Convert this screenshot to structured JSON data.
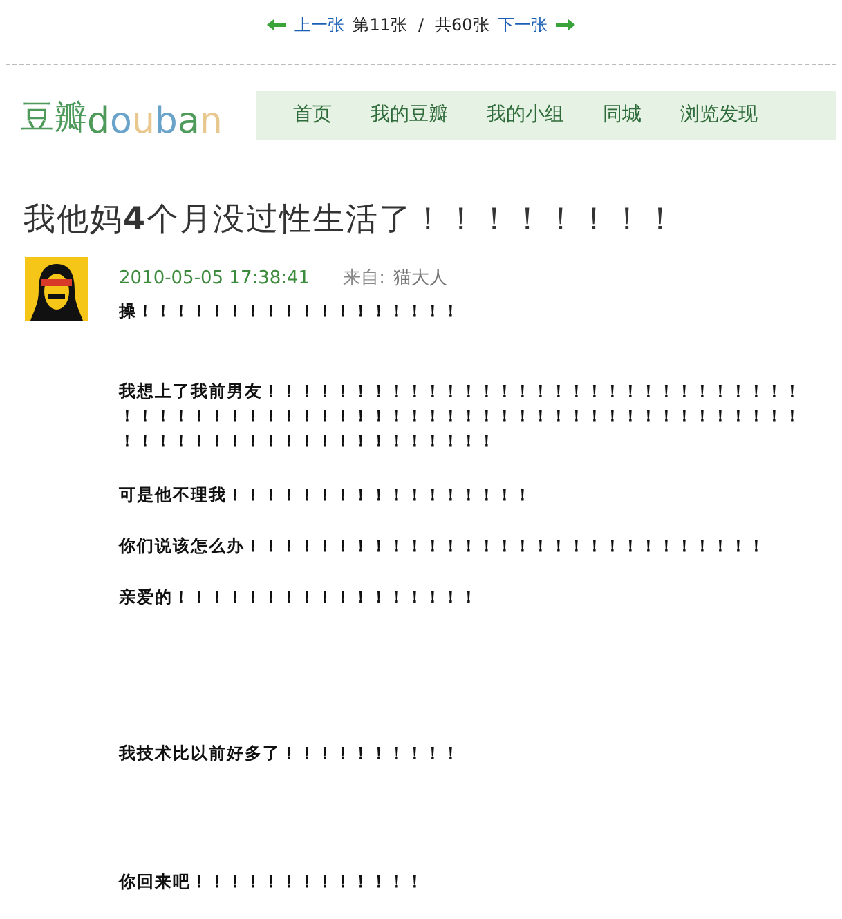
{
  "pager": {
    "prev": "上一张",
    "current": "第11张",
    "separator": "/",
    "total": "共60张",
    "next": "下一张"
  },
  "header": {
    "logo_cn": "豆瓣",
    "logo_en": "douban",
    "nav": [
      "首页",
      "我的豆瓣",
      "我的小组",
      "同城",
      "浏览发现"
    ]
  },
  "post": {
    "title": "我他妈**4**个月没过性生活了！！！！！！！！",
    "date": "2010-05-05 17:38:41",
    "from_label": "来自:",
    "author": "猫大人",
    "paragraphs": [
      "操！！！！！！！！！！！！！！！！！！",
      "我想上了我前男友！！！！！！！！！！！！！！！！！！！！！！！！！！！！！！！！！！！！！！！！！！！！！！！！！！！！！！！！！！！！！！！！！！！！！！！！！！！！！！！！！！！！！！！！！",
      "可是他不理我！！！！！！！！！！！！！！！！！",
      "你们说该怎么办！！！！！！！！！！！！！！！！！！！！！！！！！！！！！",
      "亲爱的！！！！！！！！！！！！！！！！！",
      "我技术比以前好多了！！！！！！！！！！",
      "你回来吧！！！！！！！！！！！！！"
    ]
  }
}
